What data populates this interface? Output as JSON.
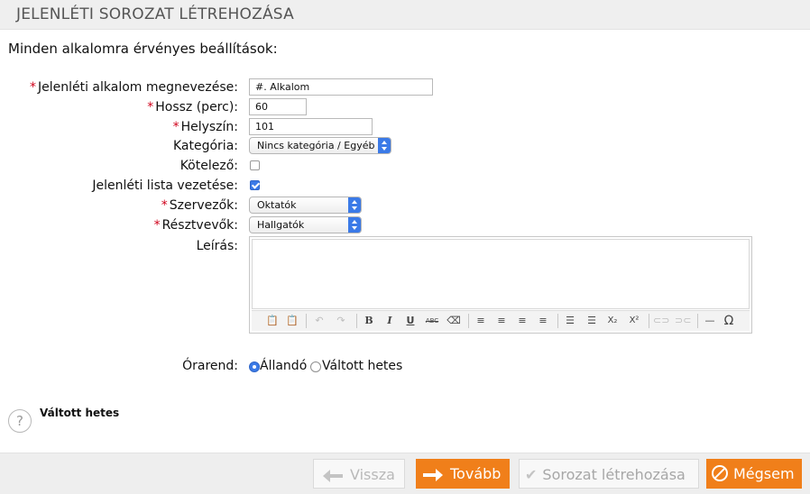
{
  "header": {
    "title": "JELENLÉTI SOROZAT LÉTREHOZÁSA"
  },
  "subtitle": "Minden alkalomra érvényes beállítások:",
  "required_mark": "*",
  "fields": {
    "name": {
      "label": "Jelenléti alkalom megnevezése:",
      "value": "#. Alkalom"
    },
    "duration": {
      "label": "Hossz (perc):",
      "value": "60"
    },
    "location": {
      "label": "Helyszín:",
      "value": "101"
    },
    "category": {
      "label": "Kategória:",
      "value": "Nincs kategória / Egyéb"
    },
    "mandatory": {
      "label": "Kötelező:",
      "checked": false
    },
    "attendance_list": {
      "label": "Jelenléti lista vezetése:",
      "checked": true
    },
    "organizers": {
      "label": "Szervezők:",
      "value": "Oktatók"
    },
    "participants": {
      "label": "Résztvevők:",
      "value": "Hallgatók"
    },
    "description": {
      "label": "Leírás:",
      "value": ""
    }
  },
  "editor_toolbar": [
    "paste-text-icon",
    "paste-word-icon",
    "undo-icon",
    "redo-icon",
    "bold-icon",
    "italic-icon",
    "underline-icon",
    "strikethrough-icon",
    "remove-format-icon",
    "align-left-icon",
    "align-center-icon",
    "align-right-icon",
    "align-justify-icon",
    "bullet-list-icon",
    "numbered-list-icon",
    "subscript-icon",
    "superscript-icon",
    "link-icon",
    "unlink-icon",
    "horizontal-rule-icon",
    "special-char-icon"
  ],
  "schedule": {
    "label": "Órarend:",
    "options": [
      {
        "label": "Állandó",
        "selected": true
      },
      {
        "label": "Váltott hetes",
        "selected": false
      }
    ]
  },
  "help": {
    "title": "Váltott hetes",
    "icon": "?"
  },
  "footer": {
    "back": "Vissza",
    "next": "Tovább",
    "create": "Sorozat létrehozása",
    "cancel": "Mégsem"
  },
  "colors": {
    "accent": "#f07f1a",
    "control_blue": "#3b7ae7",
    "required": "#d0021b"
  }
}
